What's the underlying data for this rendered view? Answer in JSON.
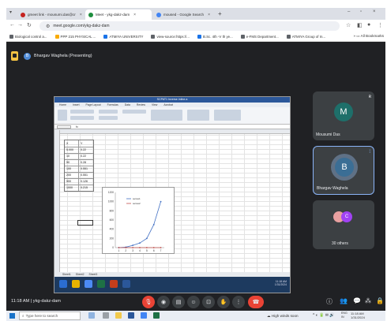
{
  "browser": {
    "tabs": [
      {
        "label": "gmeet link - mousumi.das@cr",
        "favicon_color": "#c5221f",
        "active": false
      },
      {
        "label": "Meet - ykg-dakz-dam",
        "favicon_color": "#1e8e3e",
        "active": true
      },
      {
        "label": "moused - Google Search",
        "favicon_color": "#4285f4",
        "active": false
      }
    ],
    "new_tab_icon": "plus-icon",
    "url": "meet.google.com/ykg-dakz-dam",
    "bookmarks": [
      {
        "label": "Biological control a...",
        "color": "#5f6368"
      },
      {
        "label": "PPP 215 PHYSICAL ...",
        "color": "#f9ab00"
      },
      {
        "label": "ATMIYA UNIVERSITY",
        "color": "#1a73e8"
      },
      {
        "label": "view-source:https://...",
        "color": "#5f6368"
      },
      {
        "label": "B.Sc. 4th -V th ye...",
        "color": "#1a73e8"
      },
      {
        "label": "e-FMS Department...",
        "color": "#5f6368"
      },
      {
        "label": "ATMIYA Group of In...",
        "color": "#5f6368"
      }
    ],
    "all_bookmarks": "All Bookmarks"
  },
  "meet": {
    "presenter_label": "Bhargav Waghela (Presenting)",
    "presenter_initial": "B",
    "meeting_time": "11:18 AM",
    "meeting_code": "ykg-dakz-dam",
    "participants": [
      {
        "name": "Mousumi Das",
        "initial": "M",
        "color": "#1e6f6a"
      },
      {
        "name": "Bhargav Waghela",
        "initial": "B",
        "color": "#3b6e95"
      },
      {
        "name": "30 others",
        "initial": "C",
        "color": "#a142f4"
      }
    ]
  },
  "shared_screen": {
    "window_title": "SCPAT1 Inverse.Inline.a",
    "ribbon_tabs": [
      "Home",
      "Insert",
      "Page Layout",
      "Formulas",
      "Data",
      "Review",
      "View",
      "Acrobat"
    ],
    "sheet_tabs": [
      "Sheet1",
      "Sheet2",
      "Sheet3"
    ],
    "table": {
      "headers": [
        "X",
        "Y"
      ],
      "rows": [
        [
          "5.000",
          "0.22"
        ],
        [
          "10",
          "0.22"
        ],
        [
          "50",
          "0.28"
        ],
        [
          "100",
          "0.551"
        ],
        [
          "200",
          "0.551"
        ],
        [
          "500",
          "0.126"
        ],
        [
          "1000",
          "0.215"
        ]
      ]
    },
    "clock_time": "11:18 AM",
    "clock_date": "1/31/2024"
  },
  "chart_data": {
    "type": "line",
    "x": [
      1,
      2,
      3,
      4,
      5,
      6,
      7
    ],
    "ylim": [
      0,
      1200
    ],
    "yticks": [
      0,
      200,
      400,
      600,
      800,
      1000,
      1200
    ],
    "series": [
      {
        "name": "series1",
        "values": [
          0,
          10,
          50,
          100,
          200,
          500,
          1000
        ],
        "color": "#4472c4"
      },
      {
        "name": "series2",
        "values": [
          0,
          0,
          0,
          0,
          0,
          0,
          0
        ],
        "color": "#c0504d"
      }
    ]
  },
  "taskbar": {
    "search_placeholder": "Type here to search",
    "weather": "High winds soon",
    "lang_top": "ENG",
    "lang_bottom": "IN",
    "time": "11:18 AM",
    "date": "1/31/2024"
  }
}
